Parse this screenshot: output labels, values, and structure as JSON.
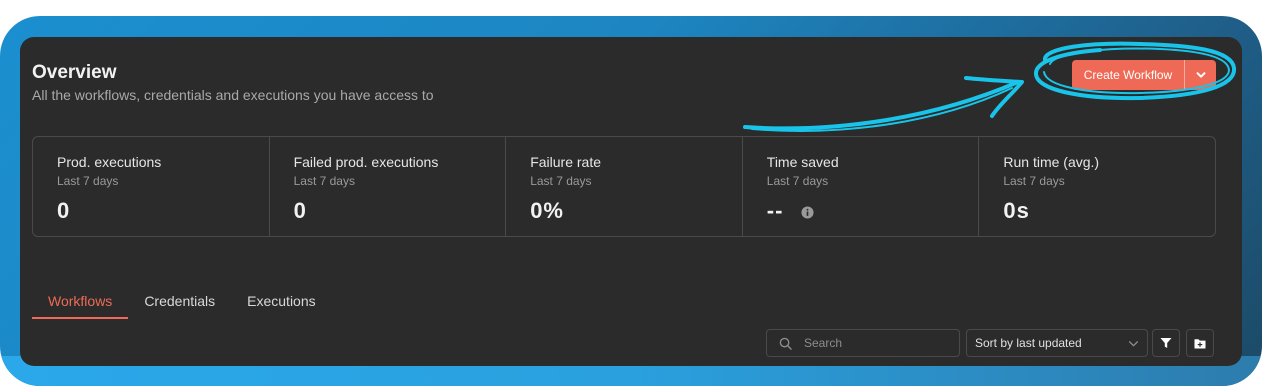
{
  "header": {
    "title": "Overview",
    "subtitle": "All the workflows, credentials and executions you have access to"
  },
  "create_button": {
    "label": "Create Workflow",
    "dropdown_icon": "chevron-down-icon"
  },
  "stats": [
    {
      "label": "Prod. executions",
      "period": "Last 7 days",
      "value": "0"
    },
    {
      "label": "Failed prod. executions",
      "period": "Last 7 days",
      "value": "0"
    },
    {
      "label": "Failure rate",
      "period": "Last 7 days",
      "value": "0%"
    },
    {
      "label": "Time saved",
      "period": "Last 7 days",
      "value": "--",
      "icon": "info-icon"
    },
    {
      "label": "Run time (avg.)",
      "period": "Last 7 days",
      "value": "0s"
    }
  ],
  "tabs": [
    {
      "label": "Workflows",
      "active": true
    },
    {
      "label": "Credentials",
      "active": false
    },
    {
      "label": "Executions",
      "active": false
    }
  ],
  "toolbar": {
    "search_placeholder": "Search",
    "sort_value": "Sort by last updated",
    "filter_icon": "filter-icon",
    "new_folder_icon": "folder-add-icon"
  },
  "colors": {
    "accent": "#ee6a56",
    "panel_bg": "#2b2b2b",
    "annotation": "#19c4ea"
  }
}
